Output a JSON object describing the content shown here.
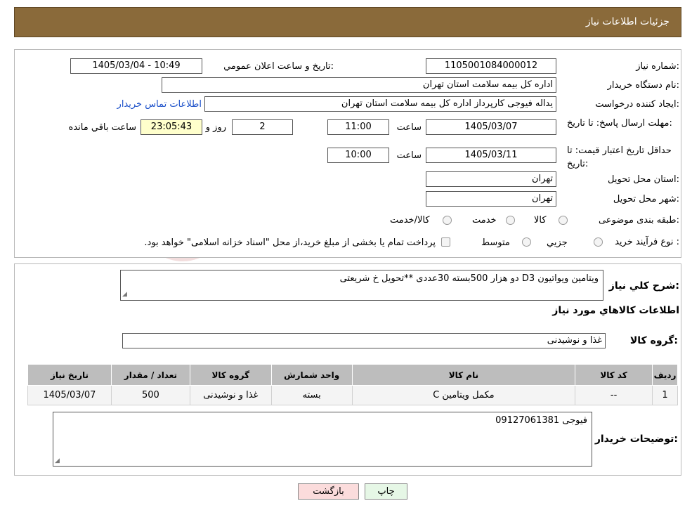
{
  "header": {
    "title": "جزئیات اطلاعات نیاز"
  },
  "need": {
    "number_label": "شماره نیاز:",
    "number": "1105001084000012",
    "announce_label": "تاریخ و ساعت اعلان عمومي:",
    "announce_value": "1405/03/04 - 10:49",
    "buyer_label": "نام دستگاه خريدار:",
    "buyer": "اداره کل بیمه سلامت استان تهران",
    "creator_label": "ايجاد کننده درخواست:",
    "creator": "یداله فیوجی کارپرداز اداره کل بیمه سلامت استان تهران",
    "contact_link": "اطلاعات تماس خريدار",
    "deadline_label": "مهلت ارسال پاسخ: تا تاريخ:",
    "deadline_date": "1405/03/07",
    "time_label": "ساعت",
    "deadline_time": "11:00",
    "days": "2",
    "days_label": "روز و",
    "remaining": "23:05:43",
    "remaining_label": "ساعت باقي مانده",
    "validity_label": "حداقل تاريخ اعتبار قيمت: تا تاريخ:",
    "validity_date": "1405/03/11",
    "validity_time": "10:00",
    "province_label": "استان محل تحويل:",
    "province": "تهران",
    "city_label": "شهر محل تحويل:",
    "city": "تهران",
    "category_label": "طبقه بندی موضوعی:",
    "category_options": [
      "كالا",
      "خدمت",
      "كالا/خدمت"
    ],
    "process_label": "نوع فرآيند خريد :",
    "process_options": [
      "جزيي",
      "متوسط"
    ],
    "process_note": "پرداخت تمام يا بخشی از مبلغ خريد،از محل \"اسناد خزانه اسلامی\" خواهد بود."
  },
  "description": {
    "label": "شرح كلي نياز:",
    "text": "ویتامین ویواتیون D3 دو هزار 500بسته 30عددی **تحویل خ شریعتی",
    "goods_info_title": "اطلاعات کالاهاي مورد نياز",
    "group_label": "گروه كالا:",
    "group": "غذا و نوشیدنی"
  },
  "table": {
    "headers": [
      "رديف",
      "کد کالا",
      "نام کالا",
      "واحد شمارش",
      "گروه کالا",
      "تعداد / مقدار",
      "تاريخ نياز"
    ],
    "rows": [
      [
        "1",
        "--",
        "مکمل ویتامین C",
        "بسته",
        "غذا و نوشیدنی",
        "500",
        "1405/03/07"
      ]
    ]
  },
  "buyer_notes": {
    "label": "توضيحات خريدار:",
    "text": "فیوجی 09127061381"
  },
  "buttons": {
    "print": "چاپ",
    "back": "بازگشت"
  },
  "watermark": {
    "text": "AriaTender.neT"
  },
  "colors": {
    "header_bg": "#8a6a3a",
    "link": "#1a4fc9",
    "timer_bg": "#ffffcc",
    "back_btn_bg": "#fbdcdc",
    "print_btn_bg": "#e6f7e6"
  }
}
